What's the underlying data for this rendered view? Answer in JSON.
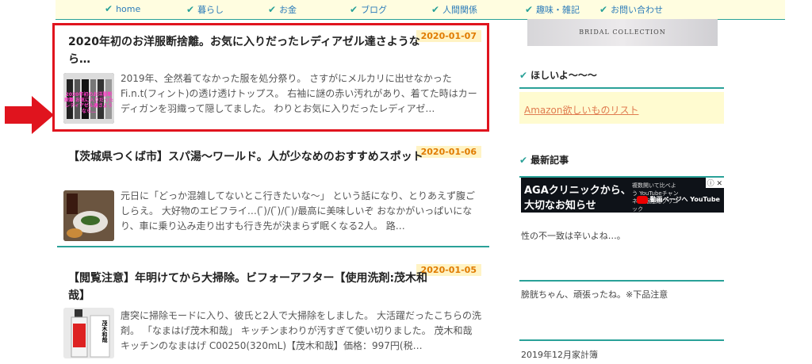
{
  "nav": {
    "items": [
      {
        "label": "home"
      },
      {
        "label": "暮らし"
      },
      {
        "label": "お金"
      },
      {
        "label": "ブログ"
      },
      {
        "label": "人間関係"
      },
      {
        "label": "趣味・雑記"
      },
      {
        "label": "お問い合わせ"
      }
    ]
  },
  "articles": [
    {
      "date": "2020-01-07",
      "title": "2020年初のお洋服断捨離。お気に入りだったレディアゼル達さようなら…",
      "excerpt": "2019年、全然着てなかった服を処分祭り。 さすがにメルカリに出せなかったFi.n.t(フィント)の透け透けトップス。 右袖に謎の赤い汚れがあり、着てた時はカーディガンを羽織って隠してました。 わりとお気に入りだったレディアゼ…",
      "thumb_overlay": "2020年初のお洋服断捨離 お気に入りだったレディアゼル達さようなら…"
    },
    {
      "date": "2020-01-06",
      "title": "【茨城県つくば市】スパ湯～ワールド。人が少なめのおすすめスポット",
      "excerpt": "元日に「どっか混雑してないとこ行きたいな～」 という話になり、とりあえず腹ごしらえ。 大好物のエビフライ…( ̄)/( ̄)/( ̄)/最高に美味しいぞ おなかがいっぱいになり、車に乗り込み走り出すも行き先が決まらず眠くなる2人。 路…"
    },
    {
      "date": "2020-01-05",
      "title": "【閲覧注意】年明けてから大掃除。ビフォーアフター【使用洗剤:茂木和哉】",
      "excerpt": "唐突に掃除モードに入り、彼氏と2人で大掃除をしました。 大活躍だったこちらの洗剤。 「なまはげ茂木和哉」 キッチンまわりが汚すぎて使い切りました。 茂木和哉 キッチンのなまはげ C00250(320mL)【茂木和哉】価格：997円(税…",
      "thumb_label": "茂木和哉"
    }
  ],
  "sidebar": {
    "banner_text": "BRIDAL COLLECTION",
    "wish_heading": "ほしいよ～～～",
    "amazon_link": "Amazon欲しいものリスト",
    "latest_heading": "最新記事",
    "ad": {
      "line1": "AGAクリニックから、",
      "line2": "大切なお知らせ",
      "small": "複数開いて比べよう YouTubeチャンネル 銀座総クリニック",
      "corner": "ⓘ ✕",
      "yt_label": "動画ページへ YouTube"
    },
    "latest_items": [
      {
        "title": "性の不一致は辛いよね…。"
      },
      {
        "title": "膀胱ちゃん、頑張ったね。※下品注意"
      },
      {
        "title": "2019年12月家計簿"
      }
    ]
  },
  "colors": {
    "accent": "#2aa198",
    "date_bg": "#fff3c4",
    "date_fg": "#e07b00",
    "highlight": "#e0141e",
    "nav_link": "#2b7bb9"
  }
}
